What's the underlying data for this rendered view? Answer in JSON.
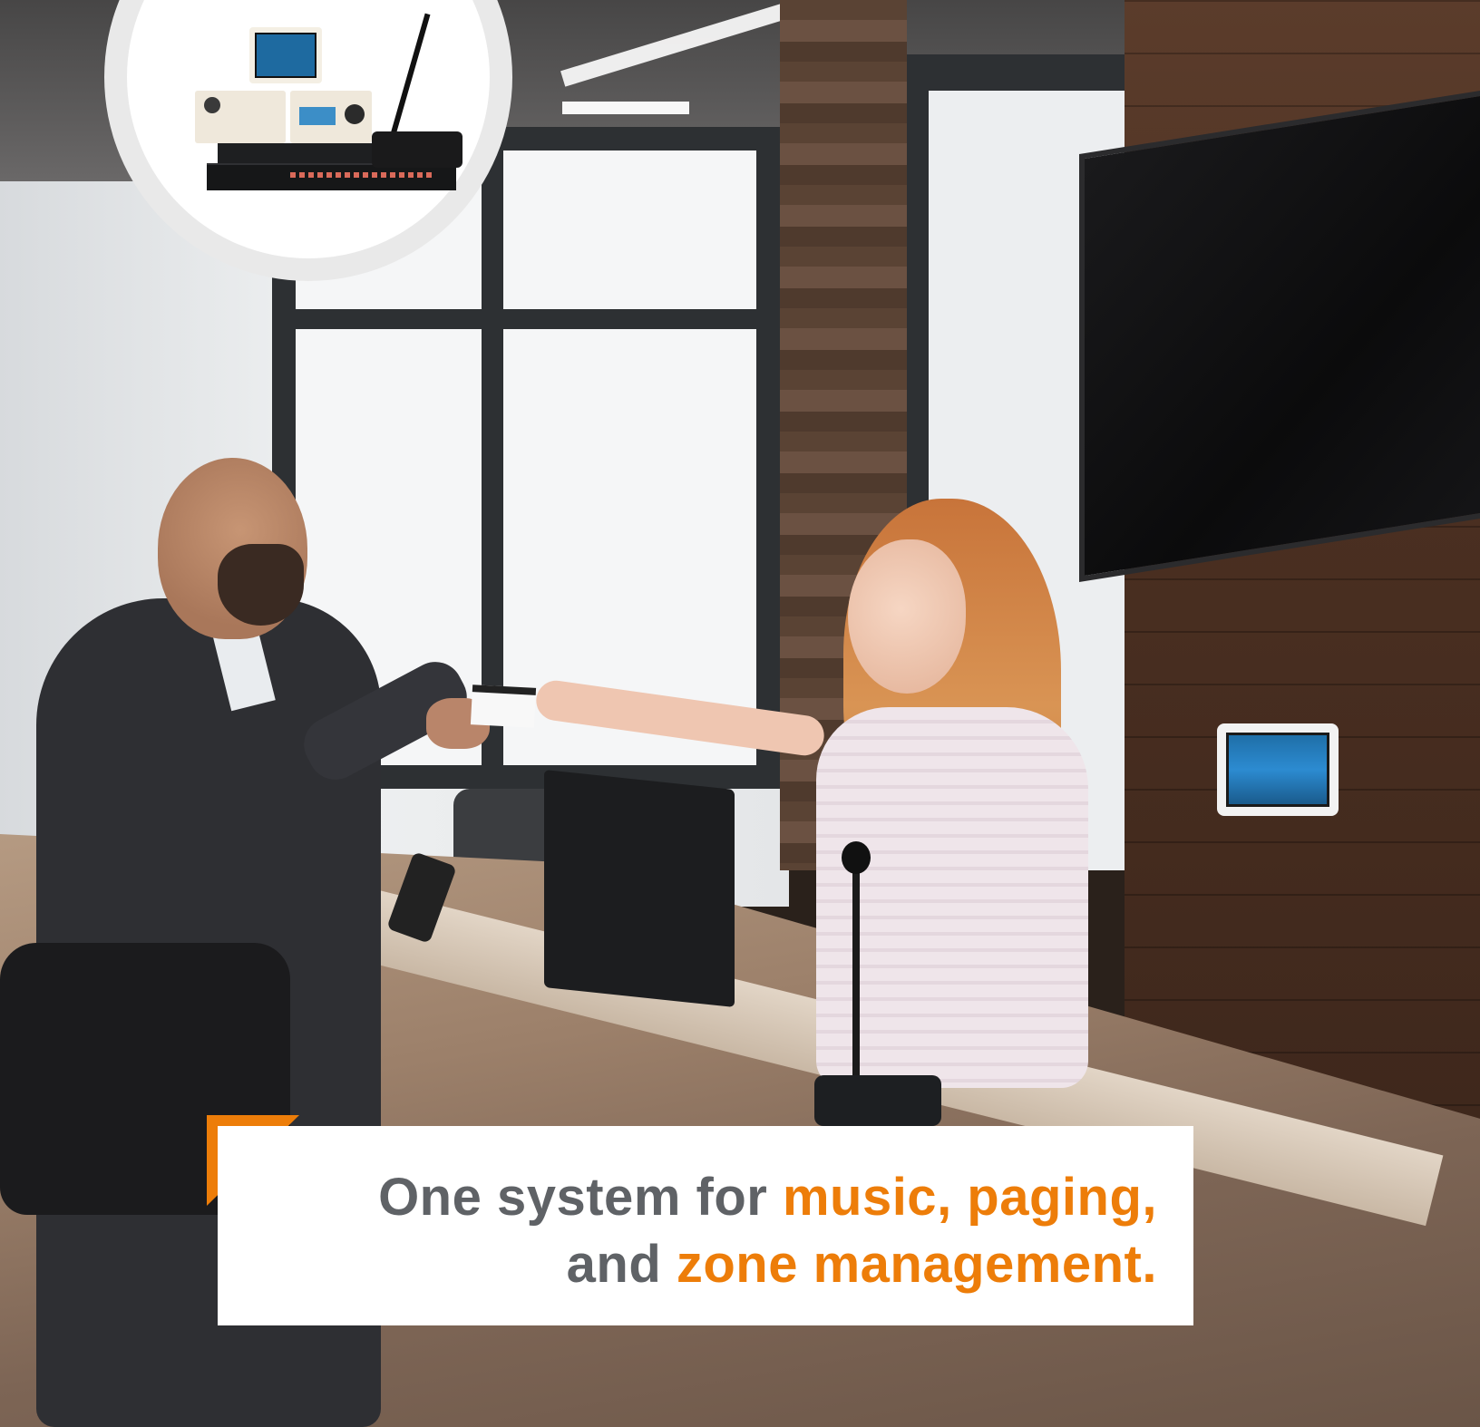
{
  "caption": {
    "line1_plain": "One system for ",
    "line1_highlight": "music, paging,",
    "line2_plain": "and ",
    "line2_highlight": "zone management."
  },
  "colors": {
    "accent": "#ed7d09",
    "caption_text": "#5f6266",
    "caption_background": "#ffffff"
  },
  "scene": {
    "icons": [
      "product-inset",
      "touch-panel",
      "paging-microphone",
      "wall-controller",
      "amplifier-rack"
    ]
  }
}
